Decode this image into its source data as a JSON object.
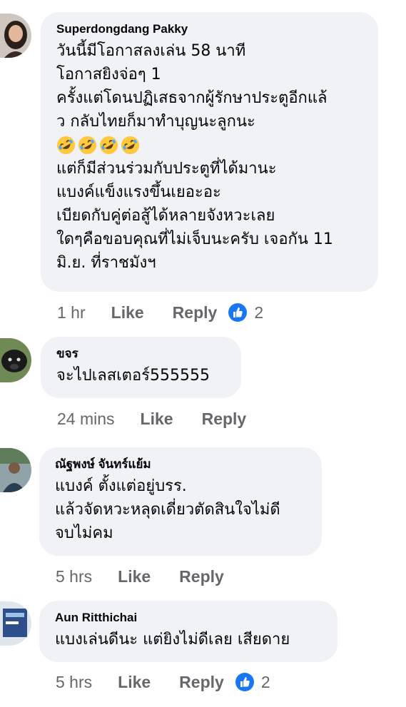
{
  "comments": [
    {
      "author": "Superdongdang Pakky",
      "lines": [
        "วันนี้มีโอกาสลงเล่น 58 นาที",
        "โอกาสยิงจ่อๆ 1",
        "ครั้งแต่โดนปฏิเสธจากผู้รักษาประตูอีกแล้",
        "ว กลับไทยก็มาทำบุญนะลูกนะ",
        "แต่ก็มีส่วนร่วมกับประตูที่ได้มานะ",
        "แบงค์แข็งแรงขึ้นเยอะอะ",
        "เบียดกับคู่ต่อสู้ได้หลายจังหวะเลย",
        "ใดๆคือขอบคุณที่ไม่เจ็บนะครับ เจอกัน 11",
        "มิ.ย. ที่ราชมังฯ"
      ],
      "emoji": [
        "rolling-on-floor-laughing",
        "rolling-on-floor-laughing",
        "rolling-on-floor-laughing",
        "rolling-on-floor-laughing"
      ],
      "time": "1 hr",
      "like_label": "Like",
      "reply_label": "Reply",
      "reaction_count": "2"
    },
    {
      "author": "ขจร",
      "lines": [
        "จะไปเลสเตอร์555555"
      ],
      "time": "24 mins",
      "like_label": "Like",
      "reply_label": "Reply"
    },
    {
      "author": "ณัฐพงษ์ จันทร์แย้ม",
      "lines": [
        "แบงค์ ตั้งแต่อยู่บรร.",
        "แล้วจัดหวะหลุดเดี่ยวตัดสินใจไม่ดี",
        "จบไม่คม"
      ],
      "time": "5 hrs",
      "like_label": "Like",
      "reply_label": "Reply"
    },
    {
      "author": "Aun Ritthichai",
      "lines": [
        "แบงเล่นดีนะ  แต่ยิงไม่ดีเลย เสียดาย"
      ],
      "time": "5 hrs",
      "like_label": "Like",
      "reply_label": "Reply",
      "reaction_count": "2"
    }
  ],
  "colors": {
    "bubble": "#f0f2f5",
    "meta": "#65676b",
    "like_blue": "#1877f2",
    "emoji_yellow": "#ffc83d"
  },
  "icons": {
    "reaction": "like-thumbs-up-icon",
    "emoji": "rolling-on-floor-laughing-emoji"
  }
}
